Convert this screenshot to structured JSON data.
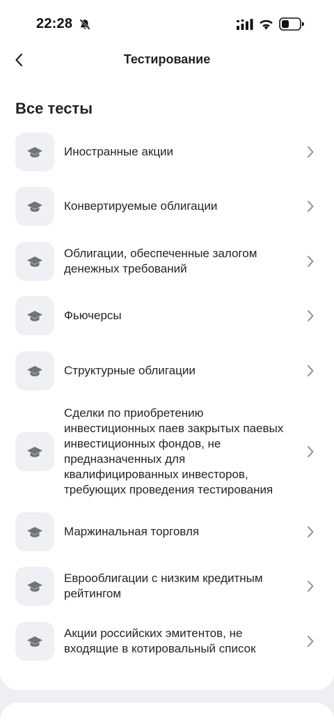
{
  "status_bar": {
    "time": "22:28"
  },
  "nav": {
    "title": "Тестирование"
  },
  "section": {
    "title": "Все тесты"
  },
  "tests": [
    {
      "label": "Иностранные акции"
    },
    {
      "label": "Конвертируемые облигации"
    },
    {
      "label": "Облигации, обеспеченные залогом денежных требований"
    },
    {
      "label": "Фьючерсы"
    },
    {
      "label": "Структурные облигации"
    },
    {
      "label": "Сделки по приобретению инвестиционных паев закрытых паевых инвестиционных фондов, не предназначенных для квалифицированных инвесторов, требующих проведения тестирования"
    },
    {
      "label": "Маржинальная торговля"
    },
    {
      "label": "Еврооблигации с низким кредитным рейтингом"
    },
    {
      "label": "Акции российских эмитентов, не входящие в котировальный список"
    }
  ],
  "icons": {
    "item_icon": "graduation-cap-icon",
    "chevron": "chevron-right-icon",
    "back": "chevron-left-icon"
  },
  "colors": {
    "icon_tile": "#eef0f4",
    "icon_glyph": "#6e737c",
    "chevron": "#8a8f98"
  }
}
